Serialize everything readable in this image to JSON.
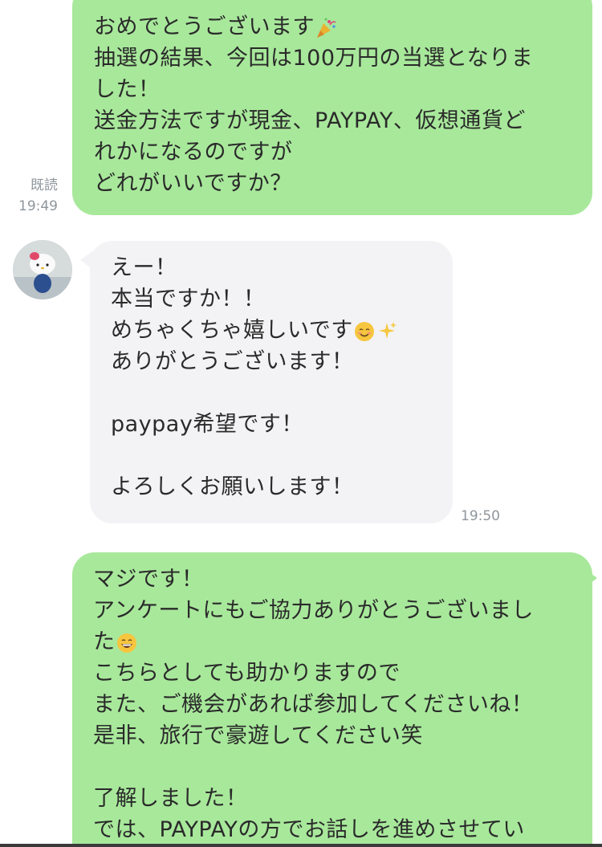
{
  "messages": [
    {
      "id": "msg1",
      "direction": "outgoing",
      "lines": [
        "おめでとうございます",
        "抽選の結果、今回は100万円の当選となりま",
        "した！",
        "送金方法ですが現金、PAYPAY、仮想通貨ど",
        "れかになるのですが",
        "どれがいいですか？"
      ],
      "line1_emoji": "party-popper-icon",
      "read_label": "既読",
      "time": "19:49"
    },
    {
      "id": "msg2",
      "direction": "incoming",
      "lines": [
        "えー！",
        "本当ですか！！",
        "めちゃくちゃ嬉しいです",
        "ありがとうございます！",
        "",
        "paypay希望です！",
        "",
        "よろしくお願いします！"
      ],
      "line3_emoji": [
        "smiling-face-icon",
        "sparkles-icon"
      ],
      "time": "19:50"
    },
    {
      "id": "msg3",
      "direction": "outgoing",
      "lines": [
        "マジです！",
        "アンケートにもご協力ありがとうございまし",
        "た",
        "こちらとしても助かりますので",
        "また、ご機会があれば参加してくださいね！",
        "是非、旅行で豪遊してください笑",
        "",
        "了解しました！",
        "では、PAYPAYの方でお話しを進めさせてい"
      ],
      "line3_emoji": "grinning-face-icon"
    }
  ],
  "colors": {
    "outgoing_bubble": "#a8e89b",
    "incoming_bubble": "#f3f3f5",
    "meta_text": "#8f969c"
  }
}
